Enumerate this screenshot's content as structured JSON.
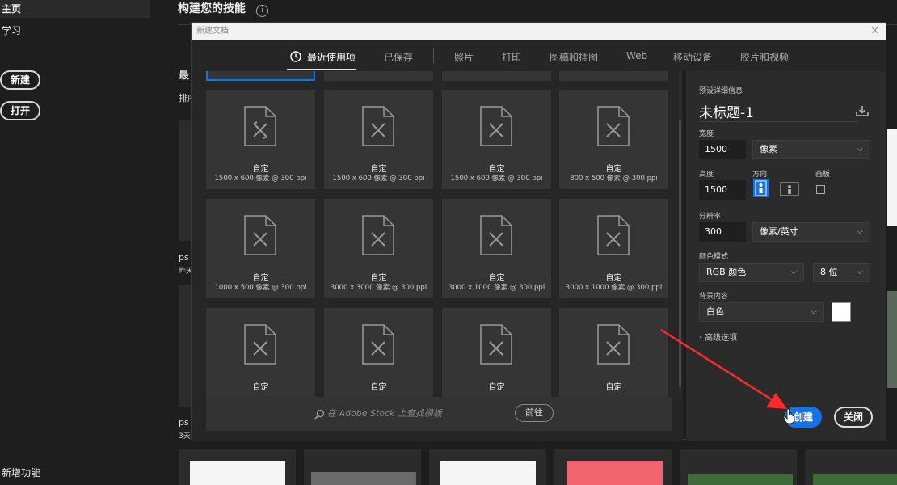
{
  "sidebar": {
    "home": "主页",
    "learn": "学习",
    "new_button": "新建",
    "open_button": "打开",
    "new_features": "新增功能"
  },
  "home": {
    "title": "构建您的技能",
    "recent_heading": "最",
    "sort_label": "排序",
    "file1_name": "ps",
    "file1_date": "昨天",
    "file2_name": "ps",
    "file2_date": "3天"
  },
  "dialog": {
    "title": "新建文档",
    "tabs": [
      "最近使用项",
      "已保存",
      "照片",
      "打印",
      "图稿和插图",
      "Web",
      "移动设备",
      "胶片和视频"
    ],
    "active_tab": 0,
    "presets": [
      {
        "name": "自定",
        "dims": "1500 x 600 像素 @ 300 ppi"
      },
      {
        "name": "自定",
        "dims": "1500 x 600 像素 @ 300 ppi"
      },
      {
        "name": "自定",
        "dims": "1500 x 600 像素 @ 300 ppi"
      },
      {
        "name": "自定",
        "dims": "800 x 500 像素 @ 300 ppi"
      },
      {
        "name": "自定",
        "dims": "1000 x 500 像素 @ 300 ppi"
      },
      {
        "name": "自定",
        "dims": "3000 x 3000 像素 @ 300 ppi"
      },
      {
        "name": "自定",
        "dims": "3000 x 1000 像素 @ 300 ppi"
      },
      {
        "name": "自定",
        "dims": "3000 x 1000 像素 @ 300 ppi"
      },
      {
        "name": "自定",
        "dims": ""
      },
      {
        "name": "自定",
        "dims": ""
      },
      {
        "name": "自定",
        "dims": ""
      },
      {
        "name": "自定",
        "dims": ""
      }
    ],
    "stock_search_placeholder": "在 Adobe Stock 上查找模板",
    "stock_go_button": "前往",
    "details": {
      "section_label": "预设详细信息",
      "doc_name": "未标题-1",
      "width_label": "宽度",
      "width_value": "1500",
      "width_unit": "像素",
      "height_label": "高度",
      "height_value": "1500",
      "orientation_label": "方向",
      "artboard_label": "画板",
      "resolution_label": "分辨率",
      "resolution_value": "300",
      "resolution_unit": "像素/英寸",
      "color_mode_label": "颜色模式",
      "color_mode_value": "RGB 颜色",
      "bit_depth_value": "8 位",
      "background_label": "背景内容",
      "background_value": "白色",
      "advanced_label": "高级选项"
    },
    "create_button": "创建",
    "close_button": "关闭"
  },
  "colors": {
    "accent": "#1473e6",
    "annotation_arrow": "#ff2a2a"
  }
}
